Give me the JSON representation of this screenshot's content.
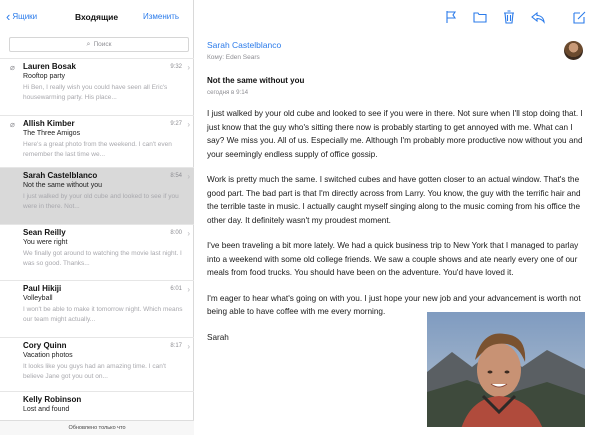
{
  "header": {
    "back_label": "Ящики",
    "mailbox_title": "Входящие",
    "edit_label": "Изменить"
  },
  "search": {
    "placeholder": "Поиск"
  },
  "messages": [
    {
      "sender": "Lauren Bosak",
      "time": "9:32",
      "subject": "Rooftop party",
      "preview": "Hi Ben, I really wish you could have seen all Eric's housewarming party. His place...",
      "has_attachment": true
    },
    {
      "sender": "Allish Kimber",
      "time": "9:27",
      "subject": "The Three Amigos",
      "preview": "Here's a great photo from the weekend. I can't even remember the last time we...",
      "has_attachment": true
    },
    {
      "sender": "Sarah Castelblanco",
      "time": "8:54",
      "subject": "Not the same without you",
      "preview": "I just walked by your old cube and looked to see if you were in there. Not...",
      "has_attachment": false,
      "selected": true
    },
    {
      "sender": "Sean Reilly",
      "time": "8:00",
      "subject": "You were right",
      "preview": "We finally got around to watching the movie last night. I was so good. Thanks...",
      "has_attachment": false
    },
    {
      "sender": "Paul Hikiji",
      "time": "6:01",
      "subject": "Volleyball",
      "preview": "I won't be able to make it tomorrow night. Which means our team might actually...",
      "has_attachment": false
    },
    {
      "sender": "Cory Quinn",
      "time": "8:17",
      "subject": "Vacation photos",
      "preview": "It looks like you guys had an amazing time. I can't believe Jane got you out on...",
      "has_attachment": false
    },
    {
      "sender": "Kelly Robinson",
      "time": "",
      "subject": "Lost and found",
      "preview": "",
      "has_attachment": false
    }
  ],
  "status": {
    "updated_label": "Обновлено только что"
  },
  "toolbar_icons": [
    "flag-icon",
    "folder-icon",
    "trash-icon",
    "reply-icon",
    "compose-icon"
  ],
  "reader": {
    "from": "Sarah Castelblanco",
    "to": "Кому: Eden Sears",
    "subject": "Not the same without you",
    "date": "сегодня в 9:14",
    "paragraphs": [
      "I just walked by your old cube and looked to see if you were in there. Not sure when I'll stop doing that. I just know that the guy who's sitting there now is probably starting to get annoyed with me. What can I say? We miss you. All of us. Especially me. Although I'm probably more productive now without you and your seemingly endless supply of office gossip.",
      "Work is pretty much the same. I switched cubes and have gotten closer to an actual window. That's the good part. The bad part is that I'm directly across from Larry. You know, the guy with the terrific hair and the terrible taste in music. I actually caught myself singing along to the music coming from his office the other day. It definitely wasn't my proudest moment.",
      "I've been traveling a bit more lately. We had a quick business trip to New York that I managed to parlay into a weekend with some old college friends. We saw a couple shows and ate nearly every one of our meals from food trucks. You should have been on the adventure. You'd have loved it.",
      "I'm eager to hear what's going on with you. I just hope your new job and your advancement is worth not being able to have coffee with me every morning.",
      "Sarah"
    ]
  },
  "colors": {
    "accent": "#2b7bea",
    "selected_row": "#d9d9d9",
    "secondary_text": "#8e8e93"
  }
}
